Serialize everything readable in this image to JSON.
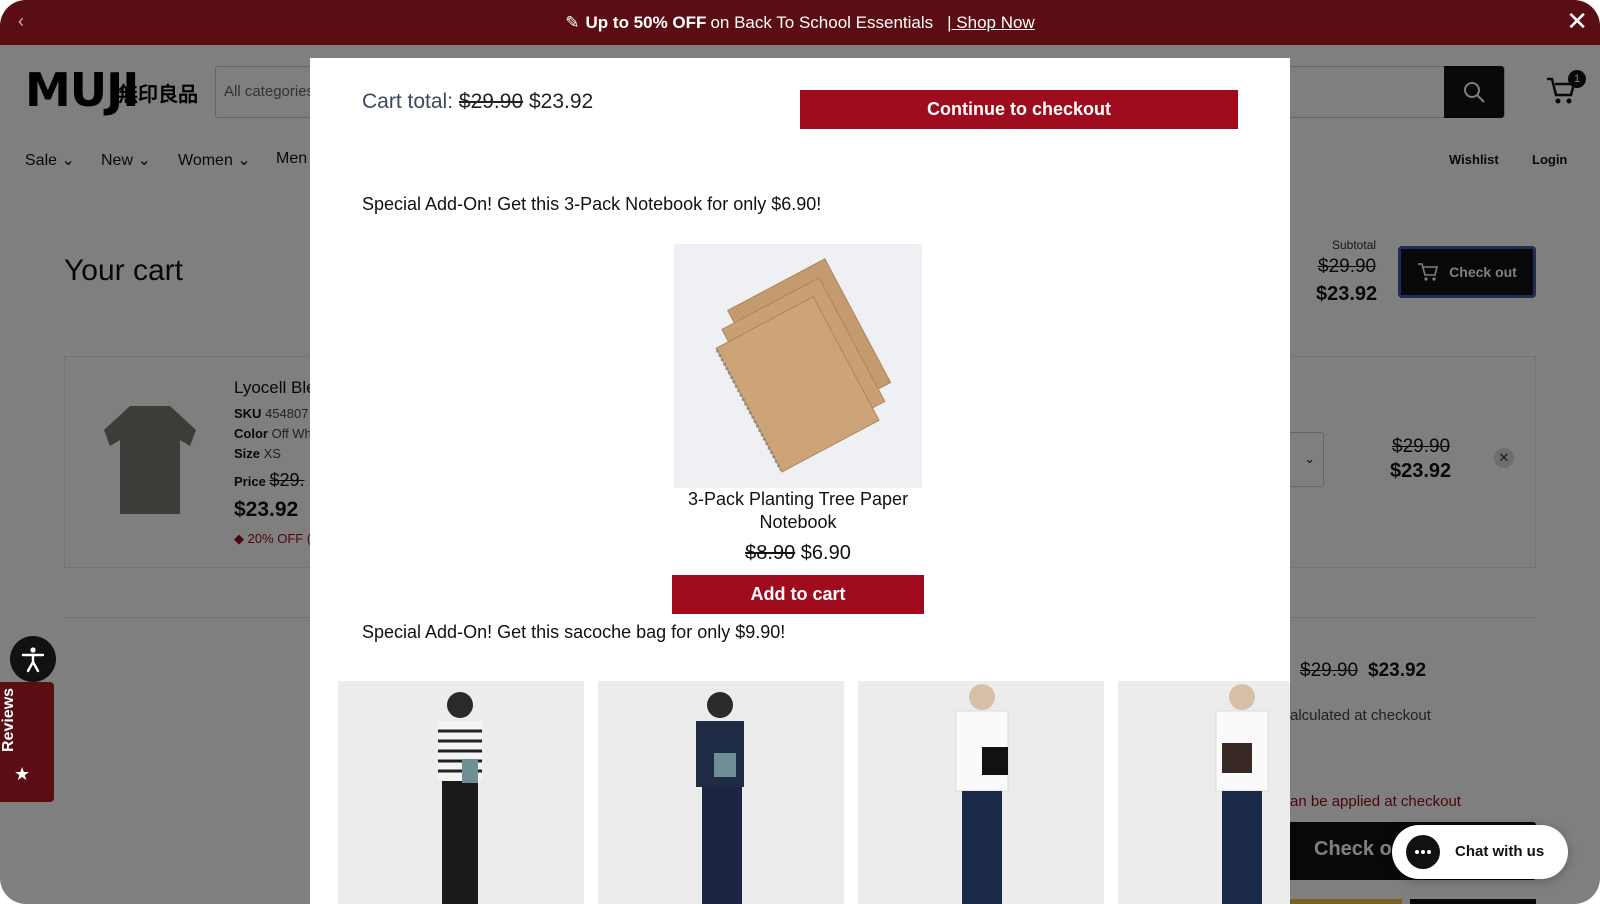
{
  "promo": {
    "highlight": "Up to 50% OFF",
    "text": "on Back To School Essentials",
    "link": "| Shop Now",
    "prev_icon": "‹",
    "close_icon": "✕"
  },
  "header": {
    "logo": "MUJI",
    "logo_jp": "無印良品",
    "search_category": "All categories",
    "cart_count": "1",
    "nav": [
      "Sale",
      "New",
      "Women",
      "Men"
    ],
    "nav_right": [
      "Wishlist",
      "Login"
    ]
  },
  "cart": {
    "title": "Your cart",
    "subtotal_label": "Subtotal",
    "subtotal_old": "$29.90",
    "subtotal_new": "$23.92",
    "checkout_label": "Check out",
    "item": {
      "name": "Lyocell Ble",
      "sku_label": "SKU",
      "sku_value": "454807",
      "color_label": "Color",
      "color_value": "Off Wh",
      "size_label": "Size",
      "size_value": "XS",
      "price_label": "Price",
      "price_old": "$29.",
      "price_new": "$23.92",
      "discount": "20% OFF (",
      "line_old": "$29.90",
      "line_new": "$23.92",
      "remove_icon": "✕"
    },
    "total_old": "$29.90",
    "total_new": "$23.92",
    "calculated": "alculated at checkout",
    "applied": "an be applied at checkout",
    "checkout_bottom": "Check ou"
  },
  "modal": {
    "cart_total_label": "Cart total:",
    "cart_total_old": "$29.90",
    "cart_total_new": "$23.92",
    "continue_label": "Continue to checkout",
    "addon1": "Special Add-On! Get this 3-Pack Notebook for only $6.90!",
    "product": {
      "name": "3-Pack Planting Tree Paper Notebook",
      "price_old": "$8.90",
      "price_new": "$6.90",
      "add_label": "Add to cart"
    },
    "addon2": "Special Add-On! Get this sacoche bag for only $9.90!"
  },
  "widgets": {
    "reviews_label": "Reviews",
    "chat_label": "Chat with us"
  },
  "colors": {
    "brand_red": "#9e0b1c",
    "promo_bg": "#5a0d12"
  }
}
